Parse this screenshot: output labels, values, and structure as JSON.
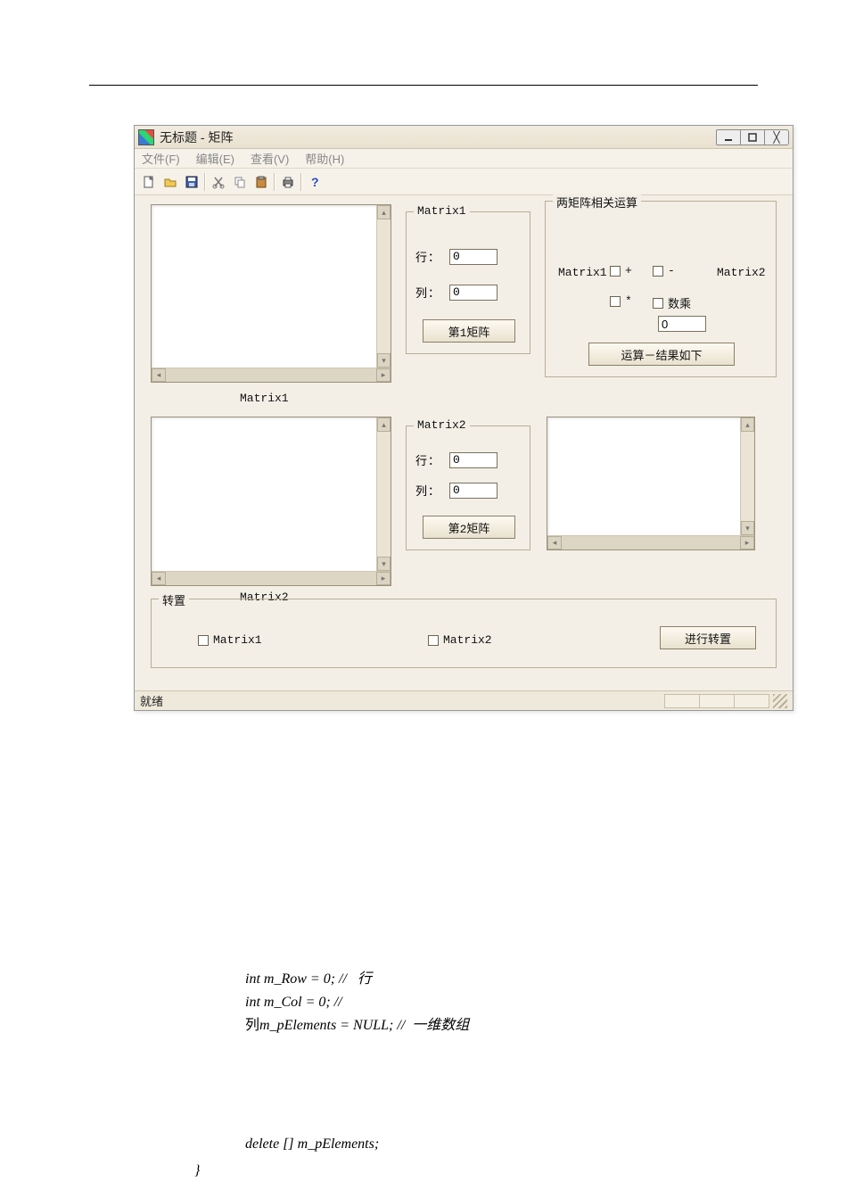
{
  "window": {
    "title": "无标题 - 矩阵",
    "menu": {
      "file": "文件(F)",
      "edit": "编辑(E)",
      "view": "查看(V)",
      "help": "帮助(H)"
    },
    "status": "就绪"
  },
  "matrix1": {
    "group_label": "Matrix1",
    "row_label": "行：",
    "row_value": "0",
    "col_label": "列：",
    "col_value": "0",
    "button": "第1矩阵",
    "caption": "Matrix1"
  },
  "matrix2": {
    "group_label": "Matrix2",
    "row_label": "行：",
    "row_value": "0",
    "col_label": "列：",
    "col_value": "0",
    "button": "第2矩阵",
    "caption": "Matrix2"
  },
  "ops": {
    "group_label": "两矩阵相关运算",
    "left": "Matrix1",
    "right": "Matrix2",
    "plus": "+",
    "minus": "-",
    "mul": "*",
    "scalar_label": "数乘",
    "scalar_value": "0",
    "result_button": "运算－结果如下"
  },
  "transpose": {
    "group_label": "转置",
    "chk1": "Matrix1",
    "chk2": "Matrix2",
    "button": "进行转置"
  },
  "code": {
    "l1": "int m_Row = 0; //   行",
    "l2": "int m_Col = 0; //",
    "l3a": "列",
    "l3b": "m_pElements = NULL; //  一维数组",
    "l4": "delete [] m_pElements;",
    "l5": "}"
  }
}
